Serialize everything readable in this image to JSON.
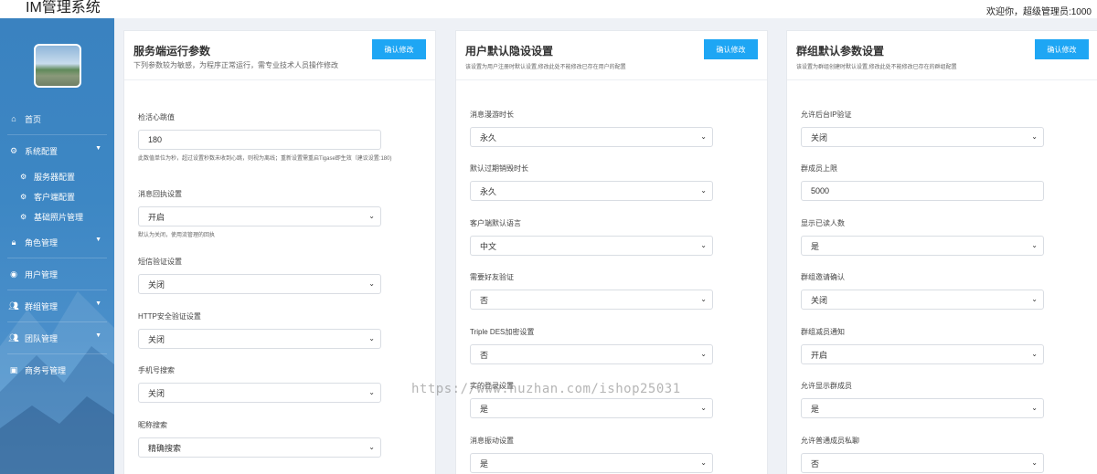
{
  "header": {
    "app_title": "IM管理系统",
    "welcome": "欢迎你，超级管理员:1000"
  },
  "sidebar": {
    "items": [
      {
        "label": "首页",
        "icon": "home-icon"
      },
      {
        "label": "系统配置",
        "icon": "gear-icon",
        "expanded": true
      },
      {
        "label": "服务器配置",
        "icon": "gears-icon"
      },
      {
        "label": "客户端配置",
        "icon": "gears-icon"
      },
      {
        "label": "基础照片管理",
        "icon": "gears-icon"
      },
      {
        "label": "角色管理",
        "icon": "lock-icon"
      },
      {
        "label": "用户管理",
        "icon": "user-circle-icon"
      },
      {
        "label": "群组管理",
        "icon": "users-icon"
      },
      {
        "label": "团队管理",
        "icon": "users-icon"
      },
      {
        "label": "商务号管理",
        "icon": "address-card-icon"
      }
    ]
  },
  "cards": [
    {
      "title": "服务端运行参数",
      "subtitle": "下列参数较为敏感，为程序正常运行，需专业技术人员操作修改",
      "button": "确认修改",
      "fields": [
        {
          "label": "检活心跳值",
          "value": "180",
          "type": "input",
          "help": "此数值单位为秒，超过设置秒数未收到心跳，则视为离线；重新设置需重启Tigase即生效（建议设置:180)"
        },
        {
          "label": "消息回执设置",
          "value": "开启",
          "type": "select",
          "help": "默认为关闭，使用流管理的回执"
        },
        {
          "label": "短信验证设置",
          "value": "关闭",
          "type": "select"
        },
        {
          "label": "HTTP安全验证设置",
          "value": "关闭",
          "type": "select"
        },
        {
          "label": "手机号搜索",
          "value": "关闭",
          "type": "select"
        },
        {
          "label": "昵称搜索",
          "value": "精确搜索",
          "type": "select"
        }
      ]
    },
    {
      "title": "用户默认隐设设置",
      "subtitle": "该设置为用户注册时默认设置,修改此处不能修改已存在用户的配置",
      "button": "确认修改",
      "fields": [
        {
          "label": "消息漫游时长",
          "value": "永久",
          "type": "select"
        },
        {
          "label": "默认过期销毁时长",
          "value": "永久",
          "type": "select"
        },
        {
          "label": "客户端默认语言",
          "value": "中文",
          "type": "select"
        },
        {
          "label": "需要好友验证",
          "value": "否",
          "type": "select"
        },
        {
          "label": "Triple DES加密设置",
          "value": "否",
          "type": "select"
        },
        {
          "label": "实的登录设置",
          "value": "是",
          "type": "select"
        },
        {
          "label": "消息振动设置",
          "value": "是",
          "type": "select"
        }
      ]
    },
    {
      "title": "群组默认参数设置",
      "subtitle": "该设置为群组创建时默认设置,修改此处不能修改已存在的群组配置",
      "button": "确认修改",
      "fields": [
        {
          "label": "允许后台IP验证",
          "value": "关闭",
          "type": "select"
        },
        {
          "label": "群成员上限",
          "value": "5000",
          "type": "input"
        },
        {
          "label": "显示已读人数",
          "value": "是",
          "type": "select"
        },
        {
          "label": "群组邀请确认",
          "value": "关闭",
          "type": "select"
        },
        {
          "label": "群组减员通知",
          "value": "开启",
          "type": "select"
        },
        {
          "label": "允许显示群成员",
          "value": "是",
          "type": "select"
        },
        {
          "label": "允许普通成员私聊",
          "value": "否",
          "type": "select"
        }
      ]
    }
  ],
  "watermark": "https://www.huzhan.com/ishop25031"
}
